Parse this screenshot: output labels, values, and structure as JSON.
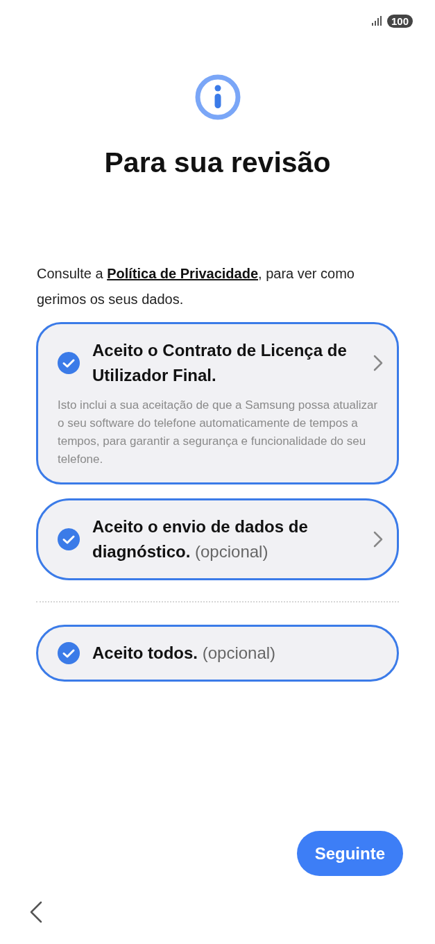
{
  "status_bar": {
    "battery": "100"
  },
  "title": "Para sua revisão",
  "intro": {
    "before": "Consulte a ",
    "link": "Política de Privacidade",
    "after": ", para ver como gerimos os seus dados."
  },
  "items": [
    {
      "kind": "details",
      "title": "Aceito o Contrato de Licença de Utilizador Final.",
      "description": "Isto inclui a sua aceitação de que a Samsung possa atualizar o seu software do telefone automaticamente de tempos a tempos, para garantir a segurança e funcionalidade do seu telefone.",
      "checked": true
    },
    {
      "kind": "details",
      "title": "Aceito o envio de dados de diagnóstico.",
      "note": "(opcional)",
      "checked": true
    },
    {
      "kind": "all",
      "title": "Aceito todos.",
      "note": "(opcional)",
      "checked": true
    }
  ],
  "next_button": "Seguinte"
}
